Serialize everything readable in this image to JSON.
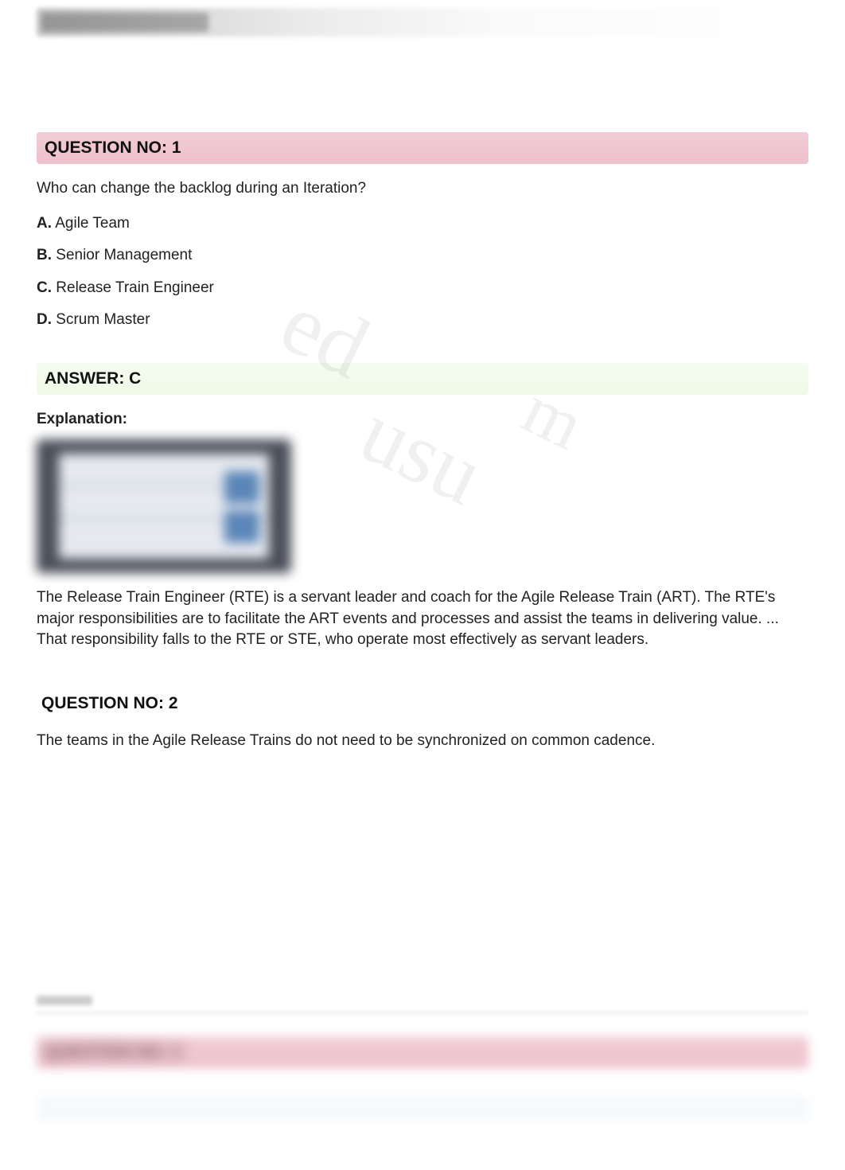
{
  "q1": {
    "header": "QUESTION NO: 1",
    "prompt": "Who can change the backlog during an Iteration?",
    "options": {
      "A": "Agile Team",
      "B": "Senior Management",
      "C": "Release Train Engineer",
      "D": "Scrum Master"
    },
    "answer_header": "ANSWER: C",
    "explanation_label": "Explanation:",
    "explanation_text": "The Release Train Engineer (RTE) is a servant leader and coach for the Agile Release Train (ART). The RTE's major responsibilities are to facilitate the ART events and processes and assist the teams in delivering value. ... That responsibility falls to the RTE or STE, who operate most effectively as servant leaders."
  },
  "q2": {
    "header": "QUESTION NO: 2",
    "prompt": "The teams in the Agile Release Trains do not need to be synchronized on common cadence."
  },
  "q3": {
    "header": "QUESTION NO: 3"
  },
  "labels": {
    "A": "A.",
    "B": "B.",
    "C": "C.",
    "D": "D."
  }
}
